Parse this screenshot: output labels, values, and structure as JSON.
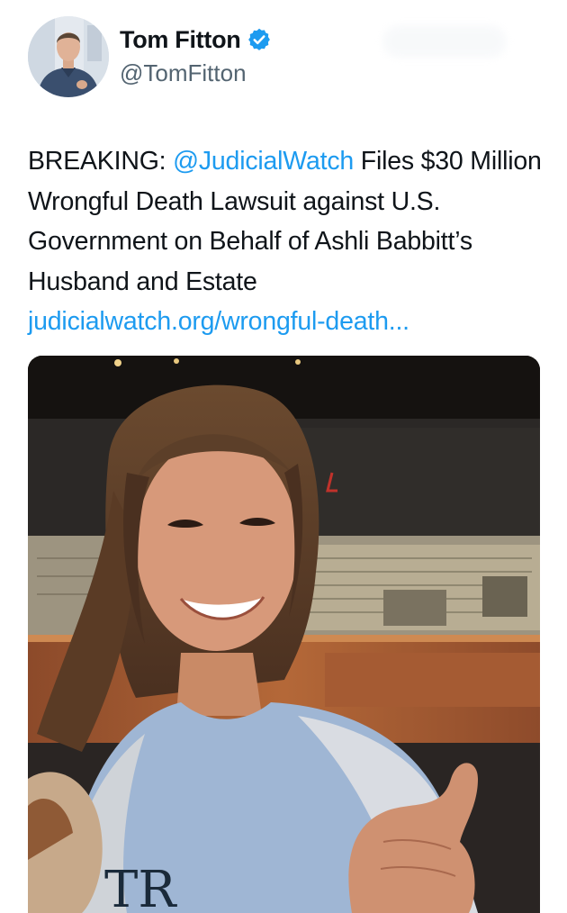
{
  "author": {
    "display_name": "Tom Fitton",
    "handle": "@TomFitton",
    "verified_icon": "verified-badge-icon",
    "avatar": "profile-photo-avatar"
  },
  "tweet": {
    "lead": "BREAKING: ",
    "mention": "@JudicialWatch",
    "body": " Files $30 Million Wrongful Death Lawsuit against U.S. Government on Behalf of Ashli Babbitt’s Husband and Estate",
    "link": "judicialwatch.org/wrongful-death..."
  },
  "media": {
    "shirt_text": "TR"
  },
  "colors": {
    "link": "#1d9bf0",
    "text": "#0f1419",
    "secondary_text": "#536471",
    "verified": "#1d9bf0"
  }
}
